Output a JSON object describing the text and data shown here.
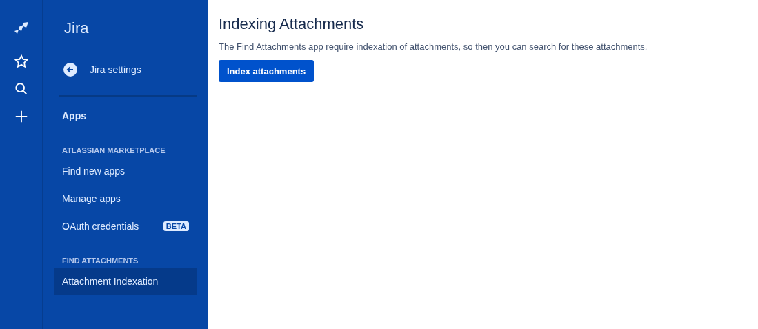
{
  "global_nav": {
    "items": [
      {
        "kind": "logo"
      },
      {
        "kind": "star"
      },
      {
        "kind": "search"
      },
      {
        "kind": "create"
      }
    ]
  },
  "sidebar": {
    "product": "Jira",
    "back_link": "Jira settings",
    "groups": [
      {
        "kind": "heading",
        "label": "Apps"
      },
      {
        "kind": "section",
        "title": "ATLASSIAN MARKETPLACE",
        "items": [
          {
            "label": "Find new apps",
            "selected": false
          },
          {
            "label": "Manage apps",
            "selected": false
          },
          {
            "label": "OAuth credentials",
            "selected": false,
            "badge": "BETA"
          }
        ]
      },
      {
        "kind": "section",
        "title": "FIND ATTACHMENTS",
        "items": [
          {
            "label": "Attachment Indexation",
            "selected": true
          }
        ]
      }
    ]
  },
  "main": {
    "title": "Indexing Attachments",
    "description": "The Find Attachments app require indexation of attachments, so then you can search for these attachments.",
    "button": "Index attachments"
  }
}
